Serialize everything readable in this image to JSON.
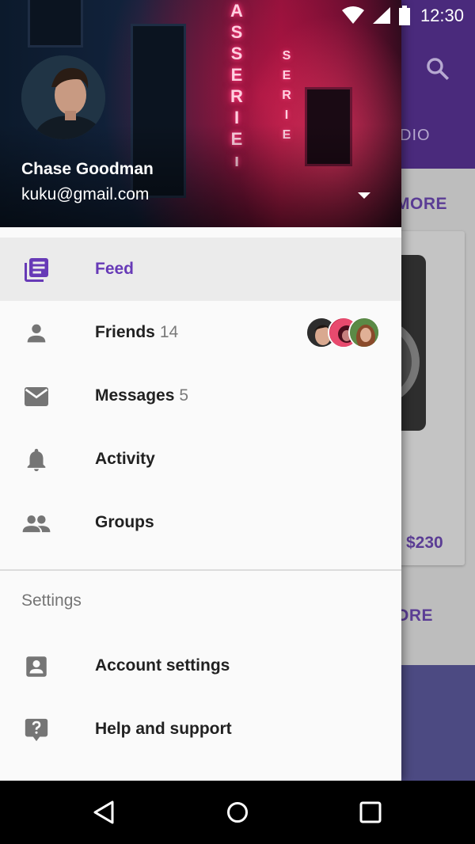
{
  "status_bar": {
    "time": "12:30",
    "icons": [
      "wifi-icon",
      "signal-icon",
      "battery-icon"
    ]
  },
  "background": {
    "tab_text": "DIO",
    "more_label_1": "MORE",
    "more_label_2": "ORE",
    "price": "$230"
  },
  "drawer": {
    "user": {
      "name": "Chase Goodman",
      "email": "kuku@gmail.com"
    },
    "accent_color": "#673ab7",
    "items": [
      {
        "label": "Feed",
        "icon": "feed-icon",
        "active": true
      },
      {
        "label": "Friends",
        "count": "14",
        "icon": "person-icon"
      },
      {
        "label": "Messages",
        "count": "5",
        "icon": "mail-icon"
      },
      {
        "label": "Activity",
        "icon": "bell-icon"
      },
      {
        "label": "Groups",
        "icon": "group-icon"
      }
    ],
    "section_title": "Settings",
    "settings_items": [
      {
        "label": "Account settings",
        "icon": "account-box-icon"
      },
      {
        "label": "Help and support",
        "icon": "help-icon"
      }
    ]
  },
  "nav_bar": {
    "buttons": [
      "back-icon",
      "home-icon",
      "recents-icon"
    ]
  }
}
